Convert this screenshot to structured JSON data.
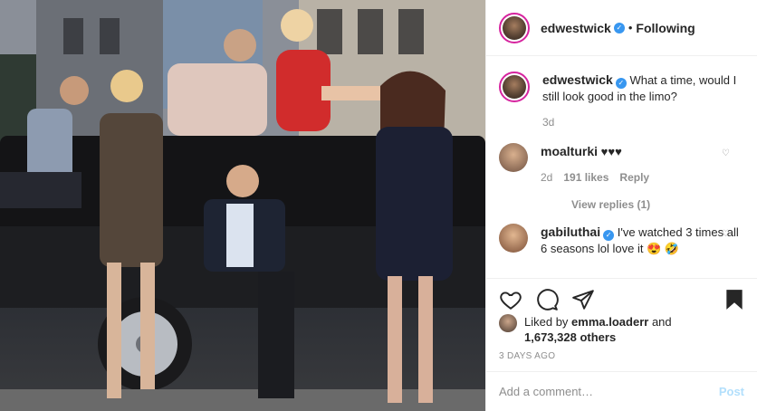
{
  "header": {
    "username": "edwestwick",
    "separator": "•",
    "follow_status": "Following"
  },
  "caption": {
    "username": "edwestwick",
    "text": "What a time, would I still look good in the limo?",
    "age": "3d"
  },
  "comments": [
    {
      "username": "moalturki",
      "text": "♥♥♥",
      "age": "2d",
      "likes": "191 likes",
      "reply_label": "Reply"
    },
    {
      "username": "gabiluthai",
      "text": "I've watched 3 times all 6 seasons lol love it 😍 🤣"
    }
  ],
  "view_replies": "View replies (1)",
  "liked_by": {
    "prefix": "Liked by",
    "user": "emma.loaderr",
    "joiner": "and",
    "others": "1,673,328 others"
  },
  "post_date": "3 DAYS AGO",
  "comment_input": {
    "placeholder": "Add a comment…",
    "post_label": "Post"
  },
  "icons": {
    "verified": "verified-badge-icon",
    "like": "heart-icon",
    "comment": "comment-icon",
    "share": "share-icon",
    "save": "bookmark-icon"
  },
  "colors": {
    "verified_blue": "#3897f0",
    "post_button_disabled": "#b2dffc",
    "avatar_ring": "#d6249f"
  }
}
